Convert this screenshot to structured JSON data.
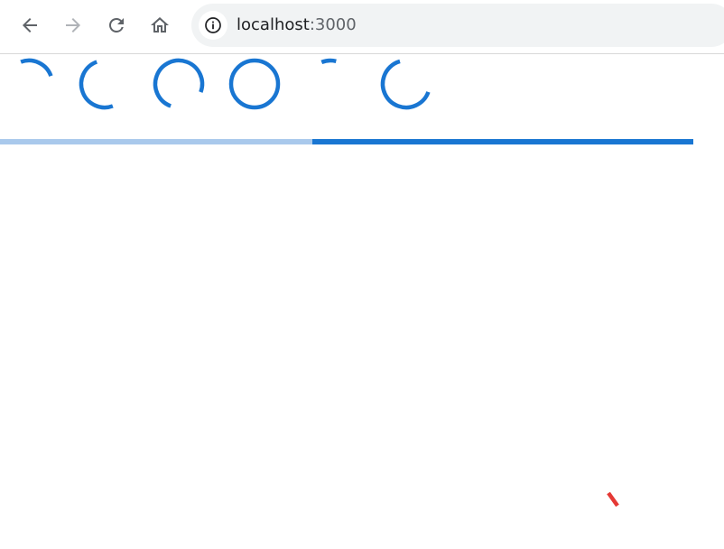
{
  "browser": {
    "url_host": "localhost",
    "url_port": ":3000",
    "icons": {
      "back": "arrow-left",
      "forward": "arrow-right",
      "reload": "reload",
      "home": "home",
      "site_info": "info-circle"
    }
  },
  "colors": {
    "spinner": "#1976d2",
    "progress_track": "#a9c9ec",
    "progress_fill": "#1976d2",
    "error_mark": "#e53935"
  },
  "spinners": [
    {
      "id": "spinner-1",
      "arc_fraction": 0.25
    },
    {
      "id": "spinner-2",
      "arc_fraction": 0.5
    },
    {
      "id": "spinner-3",
      "arc_fraction": 0.75
    },
    {
      "id": "spinner-4",
      "arc_fraction": 1.0
    },
    {
      "id": "spinner-5",
      "arc_fraction": 0.1
    },
    {
      "id": "spinner-6",
      "arc_fraction": 0.65
    }
  ],
  "progress": {
    "buffer_fraction": 1.0,
    "value_fraction": 0.55
  }
}
